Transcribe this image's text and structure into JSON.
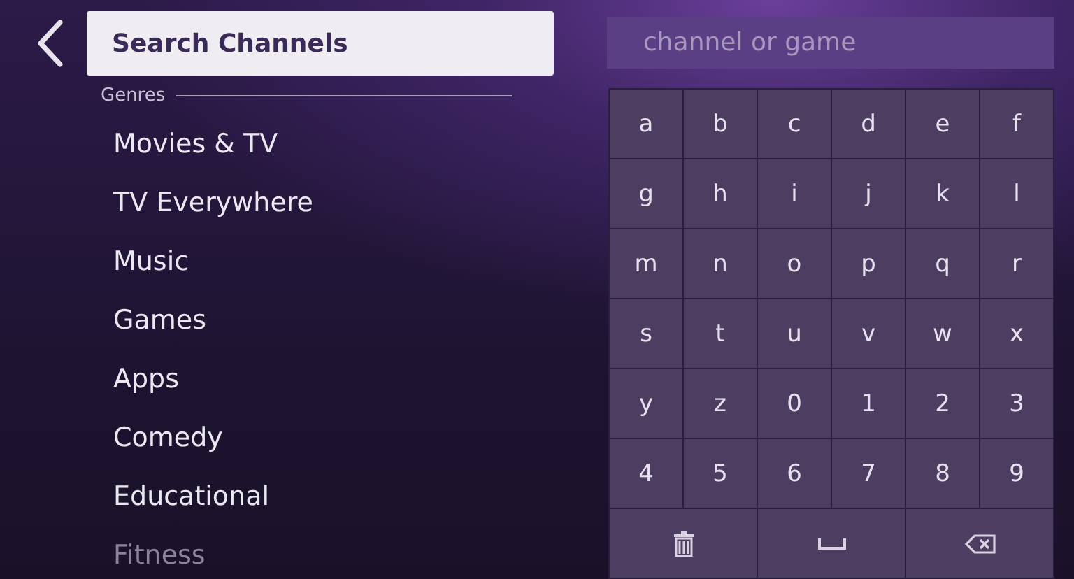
{
  "header": {
    "selected_item": "Search Channels"
  },
  "genres": {
    "heading": "Genres",
    "items": [
      {
        "label": "Movies & TV",
        "dimmed": false
      },
      {
        "label": "TV Everywhere",
        "dimmed": false
      },
      {
        "label": "Music",
        "dimmed": false
      },
      {
        "label": "Games",
        "dimmed": false
      },
      {
        "label": "Apps",
        "dimmed": false
      },
      {
        "label": "Comedy",
        "dimmed": false
      },
      {
        "label": "Educational",
        "dimmed": false
      },
      {
        "label": "Fitness",
        "dimmed": true
      }
    ]
  },
  "search": {
    "placeholder": "channel or game"
  },
  "keyboard": {
    "keys": [
      "a",
      "b",
      "c",
      "d",
      "e",
      "f",
      "g",
      "h",
      "i",
      "j",
      "k",
      "l",
      "m",
      "n",
      "o",
      "p",
      "q",
      "r",
      "s",
      "t",
      "u",
      "v",
      "w",
      "x",
      "y",
      "z",
      "0",
      "1",
      "2",
      "3",
      "4",
      "5",
      "6",
      "7",
      "8",
      "9"
    ]
  }
}
